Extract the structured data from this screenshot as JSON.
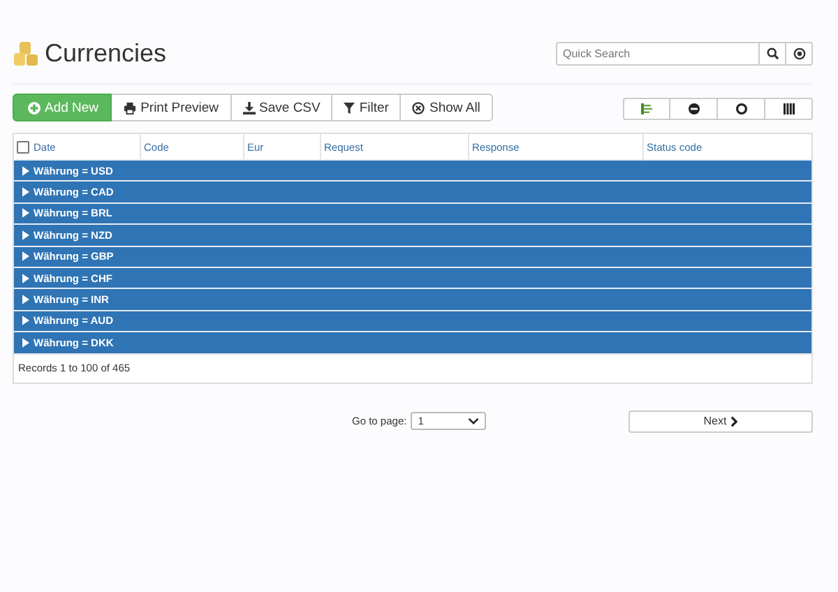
{
  "page": {
    "title": "Currencies"
  },
  "search": {
    "placeholder": "Quick Search"
  },
  "toolbar": [
    {
      "kind": "add",
      "label": "Add New"
    },
    {
      "kind": "print",
      "label": "Print Preview"
    },
    {
      "kind": "csv",
      "label": "Save CSV"
    },
    {
      "kind": "filter",
      "label": "Filter"
    },
    {
      "kind": "showall",
      "label": "Show All"
    }
  ],
  "view_buttons": [
    {
      "kind": "group"
    },
    {
      "kind": "collapse"
    },
    {
      "kind": "expand"
    },
    {
      "kind": "columns"
    }
  ],
  "table": {
    "select_all": {
      "checked": false
    },
    "columns": [
      "Date",
      "Code",
      "Eur",
      "Request",
      "Response",
      "Status code"
    ],
    "groups": [
      {
        "label": "Währung = USD",
        "expanded": false
      },
      {
        "label": "Währung = CAD",
        "expanded": false
      },
      {
        "label": "Währung = BRL",
        "expanded": false
      },
      {
        "label": "Währung = NZD",
        "expanded": false
      },
      {
        "label": "Währung = GBP",
        "expanded": false
      },
      {
        "label": "Währung = CHF",
        "expanded": false
      },
      {
        "label": "Währung = INR",
        "expanded": false
      },
      {
        "label": "Währung = AUD",
        "expanded": false
      },
      {
        "label": "Währung = DKK",
        "expanded": false
      }
    ],
    "footer": "Records 1 to 100 of 465"
  },
  "pager": {
    "label": "Go to page:",
    "page": "1",
    "next": "Next"
  }
}
